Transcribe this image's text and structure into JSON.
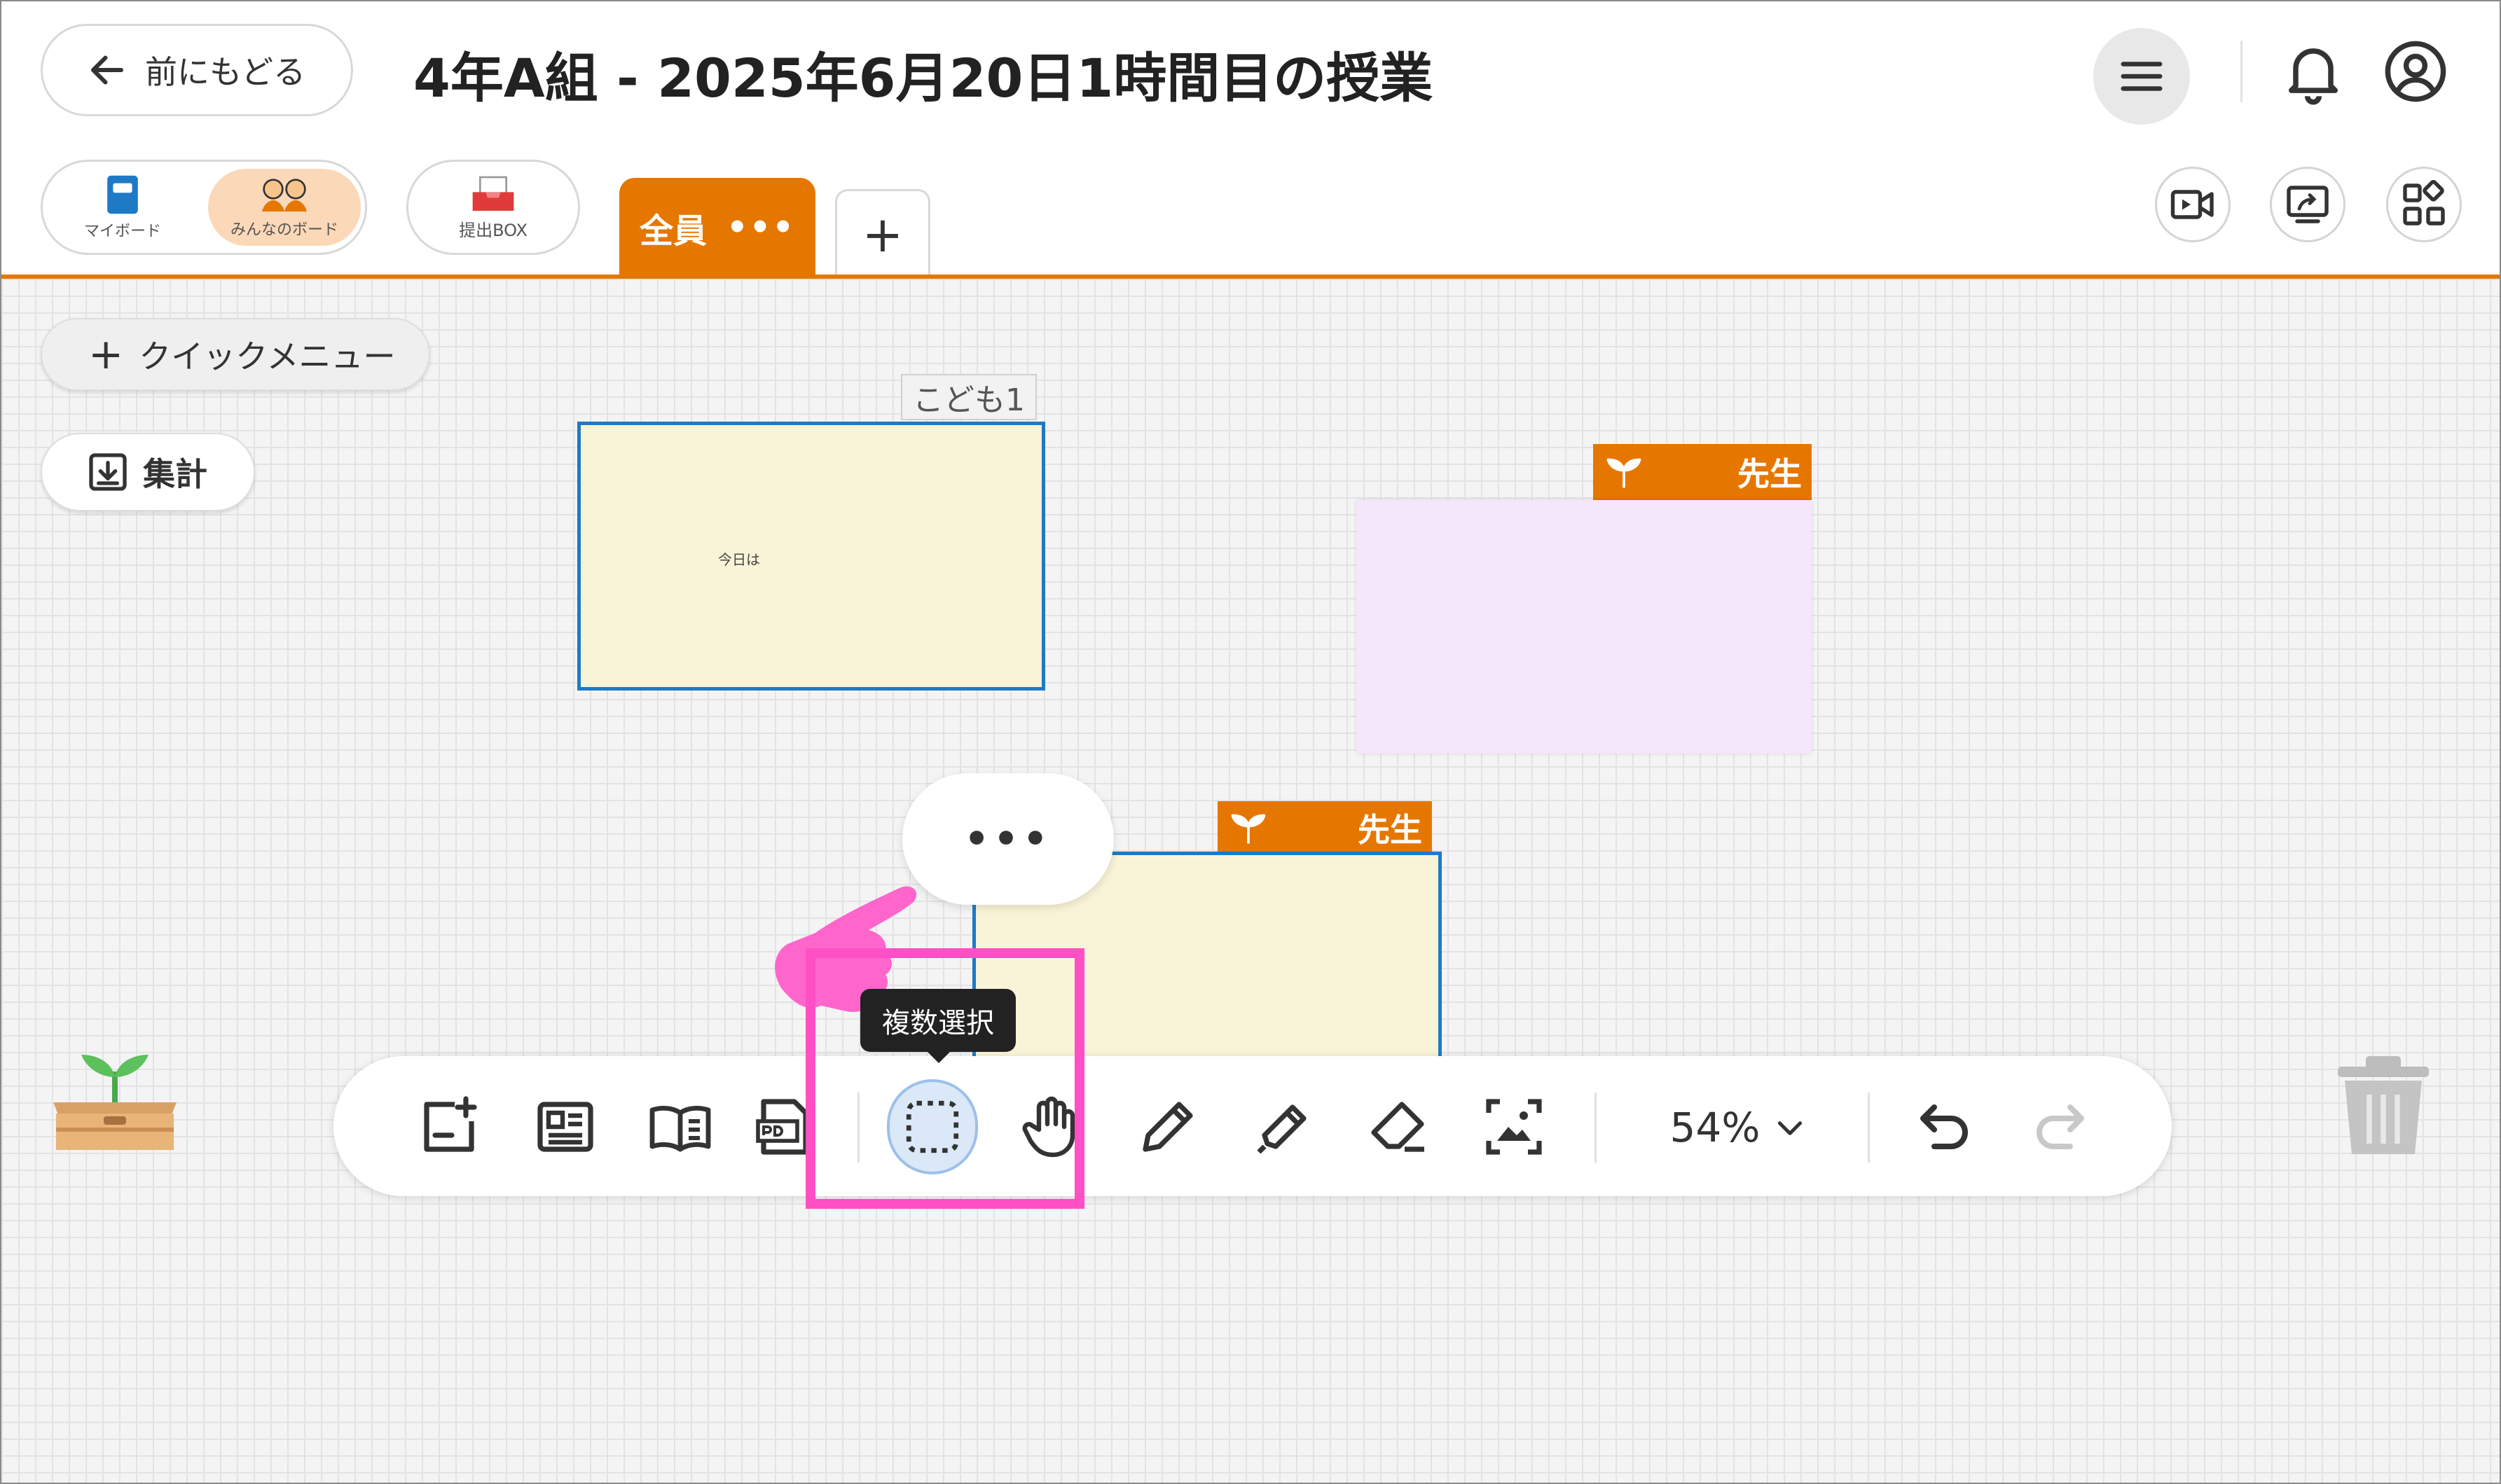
{
  "header": {
    "back_label": "前にもどる",
    "title": "4年A組 - 2025年6月20日1時間目の授業"
  },
  "boards": {
    "my_board_label": "マイボード",
    "everyone_board_label": "みんなのボード",
    "submit_box_label": "提出BOX"
  },
  "tabs": {
    "active_label": "全員",
    "active_more": "•••",
    "add_label": "+"
  },
  "canvas": {
    "quick_menu_plus": "+",
    "quick_menu_label": "クイックメニュー",
    "summary_label": "集計",
    "card1_owner": "こども1",
    "card1_text": "今日は",
    "card2_owner": "先生",
    "card3_owner": "先生",
    "more_label": "•••"
  },
  "toolbar": {
    "tooltip": "複数選択",
    "zoom": "54%"
  },
  "colors": {
    "accent": "#e57700",
    "selection_border": "#1e7ac5",
    "card_yellow": "#f9f4d8",
    "card_purple": "#f4e6fb",
    "annotation_pink": "#ff4fc4"
  }
}
